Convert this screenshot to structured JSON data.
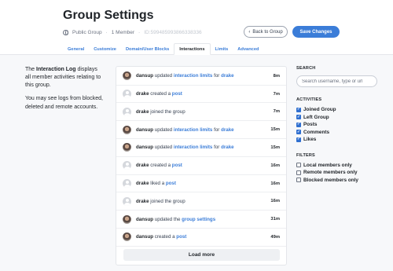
{
  "header": {
    "title": "Group Settings",
    "privacy": "Public Group",
    "members": "1 Member",
    "group_id": "ID:599485993866338336",
    "back_label": "Back to Group",
    "back_icon": "chevron-left-icon",
    "save_label": "Save Changes"
  },
  "tabs": [
    "General",
    "Customize",
    "Domain/User Blocks",
    "Interactions",
    "Limits",
    "Advanced"
  ],
  "active_tab": "Interactions",
  "intro": {
    "p1_before": "The ",
    "p1_bold": "Interaction Log",
    "p1_after": " displays all member activities relating to this group.",
    "p2": "You may see logs from blocked, deleted and remote accounts."
  },
  "log": [
    {
      "user": "dansup",
      "avatar": "photo",
      "verb": "updated",
      "link": "interaction limits",
      "conn": "for",
      "target": "drake",
      "time": "8m"
    },
    {
      "user": "drake",
      "avatar": "default",
      "verb": "created a",
      "link": "post",
      "conn": "",
      "target": "",
      "time": "7m"
    },
    {
      "user": "drake",
      "avatar": "default",
      "verb": "joined the group",
      "link": "",
      "conn": "",
      "target": "",
      "time": "7m"
    },
    {
      "user": "dansup",
      "avatar": "photo",
      "verb": "updated",
      "link": "interaction limits",
      "conn": "for",
      "target": "drake",
      "time": "15m"
    },
    {
      "user": "dansup",
      "avatar": "photo",
      "verb": "updated",
      "link": "interaction limits",
      "conn": "for",
      "target": "drake",
      "time": "15m"
    },
    {
      "user": "drake",
      "avatar": "default",
      "verb": "created a",
      "link": "post",
      "conn": "",
      "target": "",
      "time": "16m"
    },
    {
      "user": "drake",
      "avatar": "default",
      "verb": "liked a",
      "link": "post",
      "conn": "",
      "target": "",
      "time": "16m"
    },
    {
      "user": "drake",
      "avatar": "default",
      "verb": "joined the group",
      "link": "",
      "conn": "",
      "target": "",
      "time": "16m"
    },
    {
      "user": "dansup",
      "avatar": "photo",
      "verb": "updated the",
      "link": "group settings",
      "conn": "",
      "target": "",
      "time": "31m"
    },
    {
      "user": "dansup",
      "avatar": "photo",
      "verb": "created a",
      "link": "post",
      "conn": "",
      "target": "",
      "time": "49m"
    }
  ],
  "load_more": "Load more",
  "sidebar": {
    "search_heading": "SEARCH",
    "search_placeholder": "Search username, type or url",
    "activities_heading": "ACTIVITIES",
    "activities": [
      {
        "label": "Joined Group",
        "checked": true
      },
      {
        "label": "Left Group",
        "checked": true
      },
      {
        "label": "Posts",
        "checked": true
      },
      {
        "label": "Comments",
        "checked": true
      },
      {
        "label": "Likes",
        "checked": true
      }
    ],
    "filters_heading": "FILTERS",
    "filters": [
      {
        "label": "Local members only",
        "checked": false
      },
      {
        "label": "Remote members only",
        "checked": false
      },
      {
        "label": "Blocked members only",
        "checked": false
      }
    ]
  },
  "colors": {
    "accent": "#3b7dd8",
    "checkbox": "#2f6fd0"
  }
}
